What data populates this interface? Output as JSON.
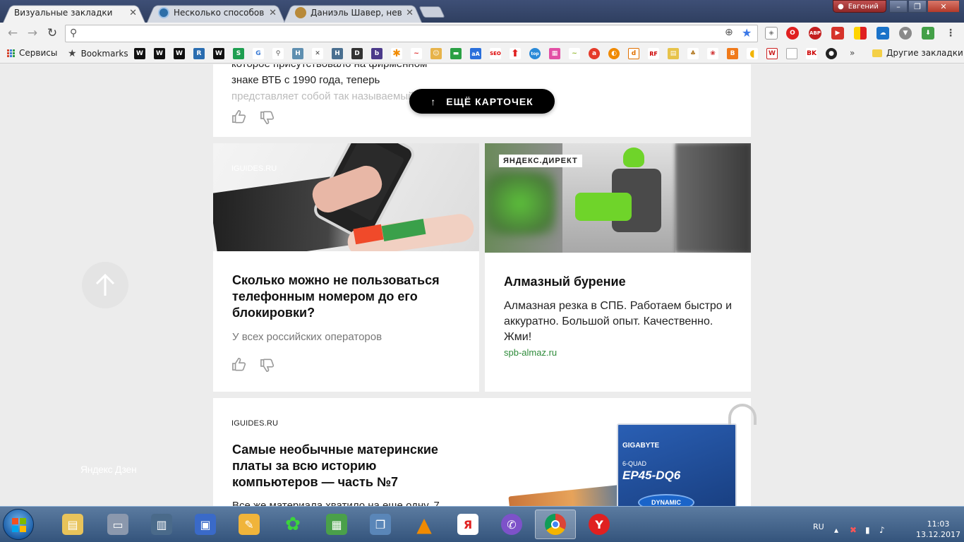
{
  "tabs": [
    {
      "title": "Визуальные закладки",
      "active": true
    },
    {
      "title": "Несколько способов по",
      "active": false
    },
    {
      "title": "Даниэль Шавер, невоор",
      "active": false
    }
  ],
  "profile": {
    "name": "Евгений"
  },
  "omnibox": {
    "value": "",
    "placeholder": ""
  },
  "bookmarks": {
    "apps_label": "Сервисы",
    "bookmarks_label": "Bookmarks",
    "other_label": "Другие закладки",
    "overflow": "»"
  },
  "page": {
    "more_button": "ЕЩЁ КАРТОЧЕК",
    "logo": "Яндекс Дзен",
    "top_card": {
      "text_line1": "которое присутствовало на фирменном",
      "text_line2": "знаке ВТБ с 1990 года, теперь",
      "text_line3": "представляет собой так называемый"
    },
    "card_phone": {
      "source": "IGUIDES.RU",
      "title": "Сколько можно не пользоваться телефонным номером до его блокировки?",
      "snippet": "У всех российских операторов"
    },
    "card_ad": {
      "badge": "ЯНДЕКС.ДИРЕКТ",
      "title": "Алмазный бурение",
      "text": "Алмазная резка в СПБ. Работаем быстро и аккуратно. Большой опыт. Качественно. Жми!",
      "domain": "spb-almaz.ru"
    },
    "card_board": {
      "source": "IGUIDES.RU",
      "title": "Самые необычные материнские платы за всю историю компьютеров — часть №7",
      "snippet": "Все же материала хватило на еще одну, 7",
      "box_brand": "GIGABYTE",
      "box_series": "6-QUAD",
      "box_model": "EP45-DQ6",
      "box_badge": "DYNAMIC"
    }
  },
  "tray": {
    "lang": "RU",
    "time": "11:03",
    "date": "13.12.2017"
  },
  "colors": {
    "accent": "#3b78e7",
    "ad_domain": "#2e8b3a",
    "page_bg": "#ececec"
  }
}
